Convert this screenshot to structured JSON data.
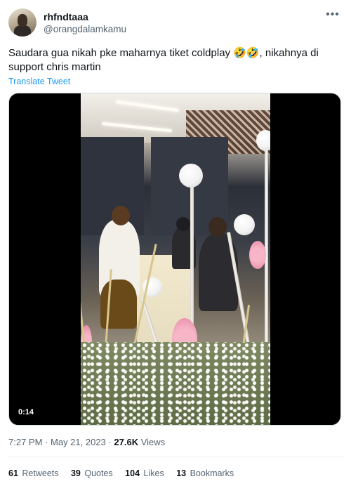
{
  "author": {
    "display_name": "rhfndtaaa",
    "handle": "@orangdalamkamu"
  },
  "more_icon": "more-horizontal-icon",
  "tweet": {
    "text": "Saudara gua nikah pke maharnya tiket coldplay 🤣🤣, nikahnya di support chris martin",
    "translate_label": "Translate Tweet"
  },
  "media": {
    "duration": "0:14"
  },
  "meta": {
    "time": "7:27 PM",
    "separator": "·",
    "date": "May 21, 2023",
    "separator2": "·",
    "views_count": "27.6K",
    "views_label": "Views"
  },
  "stats": {
    "retweets": {
      "count": "61",
      "label": "Retweets"
    },
    "quotes": {
      "count": "39",
      "label": "Quotes"
    },
    "likes": {
      "count": "104",
      "label": "Likes"
    },
    "bookmarks": {
      "count": "13",
      "label": "Bookmarks"
    }
  },
  "colors": {
    "link": "#1d9bf0",
    "secondary_text": "#536471",
    "primary_text": "#0f1419"
  }
}
